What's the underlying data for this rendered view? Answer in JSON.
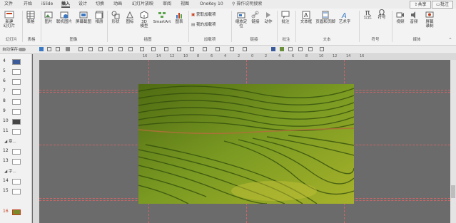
{
  "tabs": [
    "文件",
    "开始",
    "iSlide",
    "插入",
    "设计",
    "切换",
    "动画",
    "幻灯片放映",
    "审阅",
    "视图",
    "OneKey 10"
  ],
  "active_tab": "插入",
  "search_text": "操作说明搜索",
  "share_label": "共享",
  "comment_label": "批注",
  "ribbon": {
    "new_slide": "新建\n幻灯片",
    "table": "表格",
    "pictures": "图片",
    "online_pictures": "联机图片",
    "screenshot": "屏幕截图",
    "album": "相册",
    "shapes": "形状",
    "icons": "图标",
    "models_3d": "3D\n模型",
    "smartart": "SmartArt",
    "chart": "图表",
    "get_addins": "获取加载项",
    "my_addins": "我的加载项",
    "link": "缩放定位",
    "hyperlink": "链接",
    "action": "动作",
    "comment": "批注",
    "textbox": "文本框",
    "header_footer": "页眉和页脚",
    "wordart": "艺术字",
    "equation": "公式",
    "symbol": "符号",
    "video": "视频",
    "audio": "音频",
    "screen_recording": "屏幕\n录制",
    "groups": [
      "幻灯片",
      "表格",
      "图像",
      "插图",
      "加载项",
      "链接",
      "批注",
      "文本",
      "符号",
      "媒体"
    ]
  },
  "qat_label": "自动保存",
  "slides": {
    "numbers": [
      "4",
      "5",
      "6",
      "7",
      "8",
      "9",
      "10",
      "11",
      "12",
      "13",
      "14",
      "15",
      "16"
    ],
    "sections": [
      "章...",
      "字..."
    ]
  },
  "ruler_labels": [
    "16",
    "14",
    "12",
    "10",
    "8",
    "6",
    "4",
    "2",
    "0",
    "2",
    "4",
    "6",
    "8",
    "10",
    "12",
    "14",
    "16"
  ],
  "colors": {
    "accent": "#c43e1c",
    "guide": "#cc6666",
    "canvas": "#6b6b6b"
  }
}
